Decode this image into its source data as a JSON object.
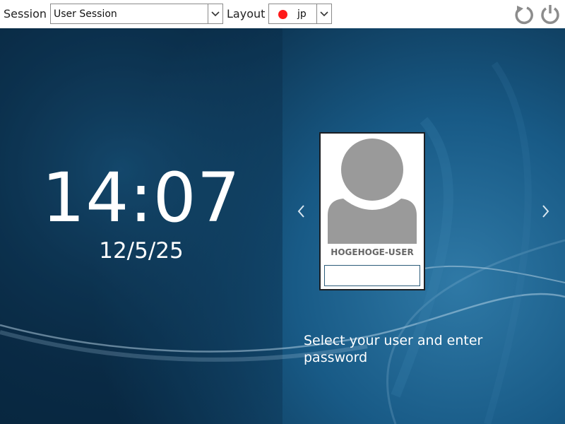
{
  "topbar": {
    "session_label": "Session",
    "session_value": "User Session",
    "layout_label": "Layout",
    "layout_value": "jp"
  },
  "icons": {
    "dropdown": "chevron-down-icon",
    "restart": "restart-icon",
    "power": "power-icon",
    "prev": "chevron-left-icon",
    "next": "chevron-right-icon",
    "layout_flag": "red-dot-icon",
    "avatar": "user-avatar-icon"
  },
  "clock": {
    "time": "14:07",
    "date": "12/5/25"
  },
  "user": {
    "name": "HOGEHOGE-USER",
    "password_value": ""
  },
  "prompt": "Select your user and enter password",
  "colors": {
    "background": "#0b3656",
    "topbar": "#ffffff",
    "text": "#ffffff",
    "layout_flag": "#ff1a1a",
    "avatar": "#9a9a9a"
  }
}
